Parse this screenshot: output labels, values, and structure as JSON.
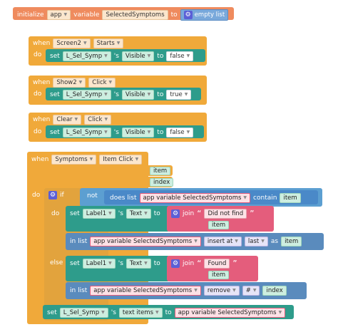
{
  "init": {
    "initialize": "initialize",
    "scope": "app",
    "variable": "variable",
    "name": "SelectedSymptoms",
    "to": "to",
    "value": "empty list"
  },
  "event1": {
    "when": "when",
    "component": "Screen2",
    "event": "Starts",
    "do": "do",
    "set": "set",
    "target": "L_Sel_Symp",
    "possessive": "'s",
    "property": "Visible",
    "to": "to",
    "value": "false"
  },
  "event2": {
    "when": "when",
    "component": "Show2",
    "event": "Click",
    "do": "do",
    "set": "set",
    "target": "L_Sel_Symp",
    "possessive": "'s",
    "property": "Visible",
    "to": "to",
    "value": "true"
  },
  "event3": {
    "when": "when",
    "component": "Clear",
    "event": "Click",
    "do": "do",
    "set": "set",
    "target": "L_Sel_Symp",
    "possessive": "'s",
    "property": "Visible",
    "to": "to",
    "value": "false"
  },
  "event4": {
    "when": "when",
    "component": "Symptoms",
    "event": "Item Click",
    "param1": "item",
    "param2": "index",
    "do": "do",
    "if": "if",
    "not": "not",
    "does_list": "does list",
    "list_var": "app variable SelectedSymptoms",
    "contain": "contain",
    "contain_item": "item",
    "then_do": "do",
    "set1": {
      "set": "set",
      "target": "Label1",
      "possessive": "'s",
      "property": "Text",
      "to": "to",
      "join": "join",
      "text": "Did not find",
      "item": "item"
    },
    "insert": {
      "in_list": "in list",
      "list_var": "app variable SelectedSymptoms",
      "mode": "insert at",
      "position": "last",
      "as": "as",
      "item": "item"
    },
    "else": "else",
    "set2": {
      "set": "set",
      "target": "Label1",
      "possessive": "'s",
      "property": "Text",
      "to": "to",
      "join": "join",
      "text": "Found",
      "item": "item"
    },
    "remove": {
      "in_list": "in list",
      "list_var": "app variable SelectedSymptoms",
      "mode": "remove",
      "op": "#",
      "index": "index"
    },
    "final_set": {
      "set": "set",
      "target": "L_Sel_Symp",
      "possessive": "'s",
      "property": "text items",
      "to": "to",
      "value": "app variable SelectedSymptoms"
    }
  }
}
